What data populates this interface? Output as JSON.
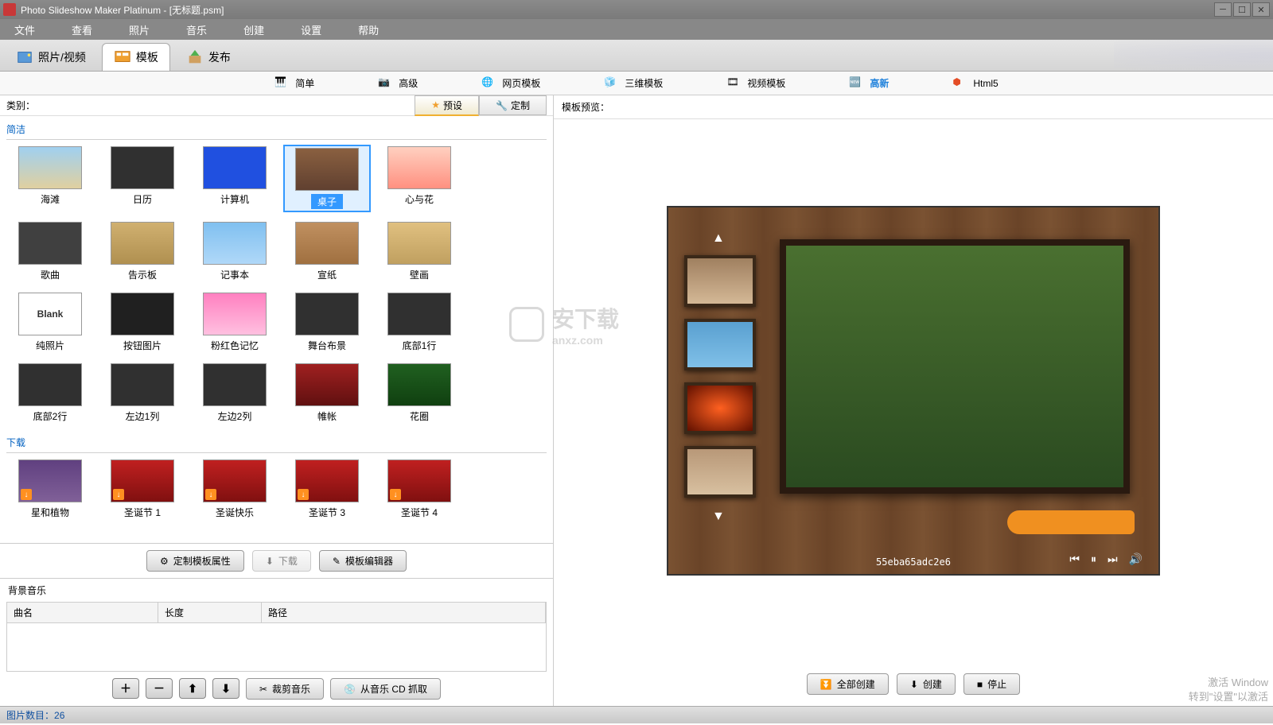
{
  "title": "Photo Slideshow Maker Platinum - [无标题.psm]",
  "menu": [
    "文件",
    "查看",
    "照片",
    "音乐",
    "创建",
    "设置",
    "帮助"
  ],
  "mainTabs": [
    {
      "label": "照片/视频",
      "active": false
    },
    {
      "label": "模板",
      "active": true
    },
    {
      "label": "发布",
      "active": false
    }
  ],
  "subTabs": [
    {
      "label": "简单",
      "icon": "piano"
    },
    {
      "label": "高级",
      "icon": "camera"
    },
    {
      "label": "网页模板",
      "icon": "globe"
    },
    {
      "label": "三维模板",
      "icon": "cubes"
    },
    {
      "label": "视频模板",
      "icon": "film"
    },
    {
      "label": "高新",
      "icon": "new",
      "active": true
    },
    {
      "label": "Html5",
      "icon": "html5"
    }
  ],
  "categoryLabel": "类别：",
  "presetTab": "预设",
  "customTab": "定制",
  "groups": [
    {
      "name": "简洁",
      "items": [
        {
          "label": "海滩",
          "thumb": "beach"
        },
        {
          "label": "日历",
          "thumb": "calendar"
        },
        {
          "label": "计算机",
          "thumb": "computer"
        },
        {
          "label": "桌子",
          "thumb": "desk",
          "selected": true
        },
        {
          "label": "心与花",
          "thumb": "heart"
        },
        {
          "label": "歌曲",
          "thumb": "song"
        },
        {
          "label": "告示板",
          "thumb": "board"
        },
        {
          "label": "记事本",
          "thumb": "notebook"
        },
        {
          "label": "宣纸",
          "thumb": "paper"
        },
        {
          "label": "壁画",
          "thumb": "mural"
        },
        {
          "label": "纯照片",
          "thumb": "blank"
        },
        {
          "label": "按钮图片",
          "thumb": "buttons"
        },
        {
          "label": "粉红色记忆",
          "thumb": "pink"
        },
        {
          "label": "舞台布景",
          "thumb": "stage"
        },
        {
          "label": "底部1行",
          "thumb": "bottom1"
        },
        {
          "label": "底部2行",
          "thumb": "bottom2"
        },
        {
          "label": "左边1列",
          "thumb": "left1"
        },
        {
          "label": "左边2列",
          "thumb": "left2"
        },
        {
          "label": "帷帐",
          "thumb": "curtain"
        },
        {
          "label": "花圈",
          "thumb": "wreath"
        }
      ]
    },
    {
      "name": "下载",
      "items": [
        {
          "label": "星和植物",
          "thumb": "star",
          "dl": true
        },
        {
          "label": "圣诞节 1",
          "thumb": "xmas1",
          "dl": true
        },
        {
          "label": "圣诞快乐",
          "thumb": "xmas2",
          "dl": true
        },
        {
          "label": "圣诞节 3",
          "thumb": "xmas3",
          "dl": true
        },
        {
          "label": "圣诞节 4",
          "thumb": "xmas4",
          "dl": true
        }
      ]
    }
  ],
  "actionButtons": {
    "custom": "定制模板属性",
    "download": "下载",
    "editor": "模板编辑器"
  },
  "bgMusicLabel": "背景音乐",
  "musicCols": {
    "name": "曲名",
    "len": "长度",
    "path": "路径"
  },
  "musicBtns": {
    "trim": "裁剪音乐",
    "rip": "从音乐 CD 抓取"
  },
  "previewLabel": "模板预览：",
  "previewId": "55eba65adc2e6",
  "rightButtons": {
    "createAll": "全部创建",
    "create": "创建",
    "stop": "停止"
  },
  "statusLabel": "图片数目：",
  "statusCount": "26",
  "watermark": {
    "text": "安下载",
    "sub": "anxz.com"
  },
  "activate": {
    "l1": "激活 Window",
    "l2": "转到\"设置\"以激活"
  }
}
